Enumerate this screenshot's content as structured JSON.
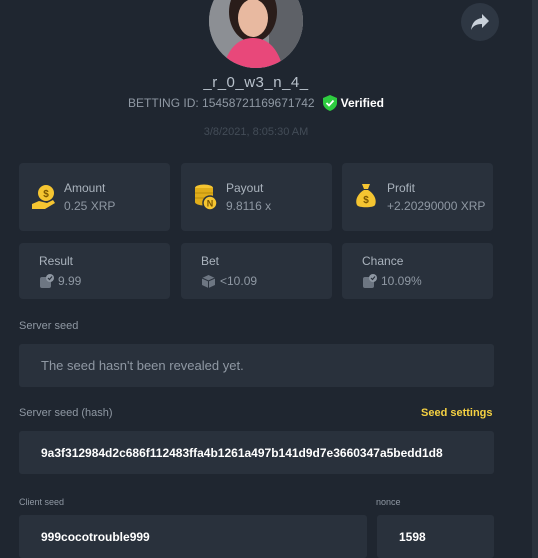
{
  "profile": {
    "username": "_r_0_w3_n_4_",
    "betting_id": "BETTING ID: 15458721169671742",
    "verified_label": "Verified",
    "datetime": "3/8/2021, 8:05:30 AM"
  },
  "stats": {
    "amount": {
      "label": "Amount",
      "value": "0.25 XRP"
    },
    "payout": {
      "label": "Payout",
      "value": "9.8116 x"
    },
    "profit": {
      "label": "Profit",
      "value": "+2.20290000 XRP"
    },
    "result": {
      "label": "Result",
      "value": "9.99"
    },
    "bet": {
      "label": "Bet",
      "value": "<10.09"
    },
    "chance": {
      "label": "Chance",
      "value": "10.09%"
    }
  },
  "server_seed": {
    "label": "Server seed",
    "value": "The seed hasn't been revealed yet."
  },
  "server_seed_hash": {
    "label": "Server seed (hash)",
    "settings_link": "Seed settings",
    "value": "9a3f312984d2c686f112483ffa4b1261a497b141d9d7e3660347a5bedd1d8"
  },
  "client_seed": {
    "label": "Client seed",
    "value": "999cocotrouble999"
  },
  "nonce": {
    "label": "nonce",
    "value": "1598"
  },
  "colors": {
    "background": "#1f2630",
    "card": "#29313c",
    "accent_yellow": "#f5d142",
    "verified_green": "#2ecc40"
  },
  "icons": {
    "share": "share-icon",
    "verified": "shield-check-icon",
    "amount": "coin-hand-icon",
    "payout": "coin-stack-icon",
    "profit": "money-bag-icon",
    "result": "dice-check-icon",
    "bet": "dice-icon",
    "chance": "dice-check-icon"
  }
}
